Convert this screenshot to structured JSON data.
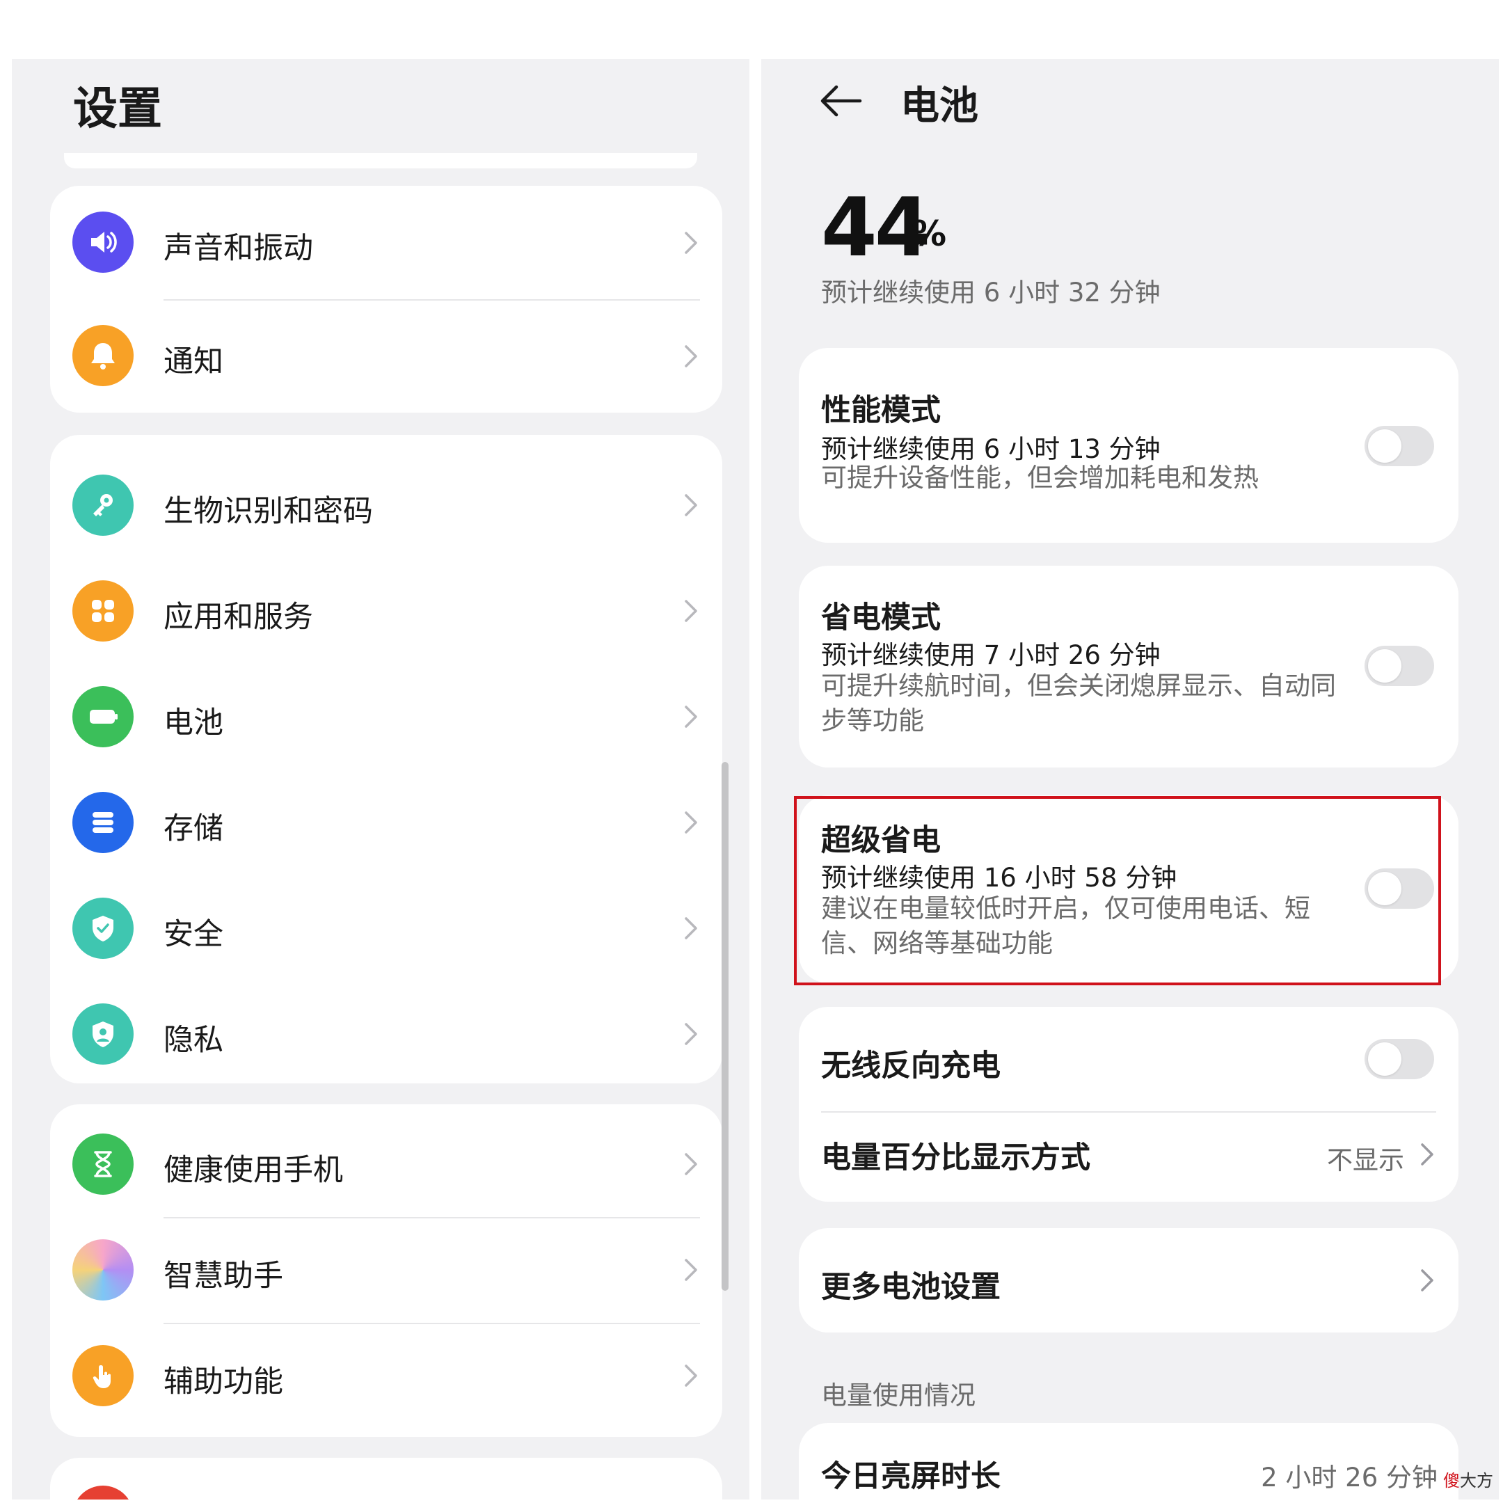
{
  "left": {
    "title": "设置",
    "groups": [
      {
        "items": [
          {
            "label": "声音和振动",
            "icon": "speaker-icon",
            "color": "#5b4ef0"
          },
          {
            "label": "通知",
            "icon": "bell-icon",
            "color": "#f8a126"
          }
        ]
      },
      {
        "items": [
          {
            "label": "生物识别和密码",
            "icon": "key-icon",
            "color": "#3fc6b0"
          },
          {
            "label": "应用和服务",
            "icon": "apps-grid-icon",
            "color": "#f8a126"
          },
          {
            "label": "电池",
            "icon": "battery-icon",
            "color": "#3bbf5a"
          },
          {
            "label": "存储",
            "icon": "storage-icon",
            "color": "#2468ea"
          },
          {
            "label": "安全",
            "icon": "shield-check-icon",
            "color": "#3fc6b0"
          },
          {
            "label": "隐私",
            "icon": "privacy-shield-icon",
            "color": "#3fc6b0"
          }
        ]
      },
      {
        "items": [
          {
            "label": "健康使用手机",
            "icon": "hourglass-icon",
            "color": "#3bbf5a"
          },
          {
            "label": "智慧助手",
            "icon": "assistant-orb-icon",
            "color": "#e58be0"
          },
          {
            "label": "辅助功能",
            "icon": "hand-pointer-icon",
            "color": "#f8a126"
          }
        ]
      }
    ]
  },
  "right": {
    "title": "电池",
    "battery": {
      "percent": "44",
      "unit": "%",
      "remaining": "预计继续使用 6 小时 32 分钟"
    },
    "modes": [
      {
        "title": "性能模式",
        "estimate": "预计继续使用 6 小时 13 分钟",
        "desc": "可提升设备性能，但会增加耗电和发热",
        "on": false
      },
      {
        "title": "省电模式",
        "estimate": "预计继续使用 7 小时 26 分钟",
        "desc": "可提升续航时间，但会关闭熄屏显示、自动同步等功能",
        "on": false
      },
      {
        "title": "超级省电",
        "estimate": "预计继续使用 16 小时 58 分钟",
        "desc": "建议在电量较低时开启，仅可使用电话、短信、网络等基础功能",
        "on": false
      }
    ],
    "wireless_reverse_charge": {
      "label": "无线反向充电",
      "on": false
    },
    "percent_display": {
      "label": "电量百分比显示方式",
      "value": "不显示"
    },
    "more_settings": {
      "label": "更多电池设置"
    },
    "usage_section_title": "电量使用情况",
    "screen_time": {
      "label": "今日亮屏时长",
      "value": "2 小时 26 分钟"
    }
  },
  "watermark": {
    "part1": "傻",
    "part2": "大方"
  },
  "colors": {
    "highlight": "#d0121b",
    "pane_bg": "#f1f1f3",
    "card_bg": "#ffffff"
  }
}
